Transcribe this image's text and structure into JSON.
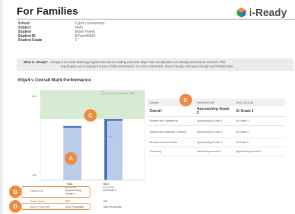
{
  "header": {
    "title": "For Families",
    "logo_text": "i-Ready"
  },
  "student_info": [
    {
      "label": "School",
      "value": "Cyprus Elementary"
    },
    {
      "label": "Subject",
      "value": "Math"
    },
    {
      "label": "Student",
      "value": "Elijah Powell"
    },
    {
      "label": "Student ID",
      "value": "EPowell6896"
    },
    {
      "label": "Student Grade",
      "value": "3"
    }
  ],
  "what_is": {
    "label": "What is i-Ready?",
    "line1": "i-Ready is an online learning program focused on reading and math. Elijah has recently taken an i-Ready assessment at school. This",
    "line2": "report gives you a snapshot of your child's performance. For more information about i-Ready, visit www.i-Ready.com/FamilyCenter."
  },
  "section_title": "Elijah's Overall Math Performance",
  "chart_data": {
    "type": "bar",
    "legend": "On Grade Level (487–540)",
    "y_ticks": [
      "540",
      "350"
    ],
    "ylim": [
      350,
      540
    ],
    "on_grade_band": [
      487,
      540
    ],
    "bars": [
      {
        "label_line1": "Test",
        "label_line2": "(09/16/20)",
        "value": 470,
        "emphasis": "solid"
      },
      {
        "label_line1": "Test",
        "label_line2": "(12/14/20)",
        "value": 487,
        "emphasis": "light"
      }
    ],
    "change_label": "+17"
  },
  "rows": {
    "placement_label": "Placement",
    "placement_values": [
      "Approaching Grade 3",
      "At Grade 3"
    ],
    "scale_label": "Scale Score",
    "scale_values": [
      "470",
      "487"
    ],
    "norm_label": "Norm Percentile",
    "norm_values": [
      "21st Percentile",
      "76th Percentile"
    ]
  },
  "table": {
    "headers": [
      "Domain",
      "Test (09/16/20)",
      "Test (12/14/20)"
    ],
    "overall": [
      "Overall",
      "Approaching Grade 3",
      "At Grade 3"
    ],
    "rows": [
      [
        "Number and Operations",
        "Approaching Grade 3",
        "At Grade 3"
      ],
      [
        "Algebra and Algebraic Thinking",
        "Approaching Grade 3",
        "At Grade 3"
      ],
      [
        "Measurement and Data",
        "Approaching Grade 3",
        "At Grade 3"
      ],
      [
        "Geometry",
        "Needs Improvement",
        "Approaching Grade 3"
      ]
    ]
  },
  "markers": {
    "a": "A",
    "b": "B",
    "c": "C",
    "d": "D",
    "e": "E"
  },
  "colors": {
    "accent": "#f08a3e",
    "band": "#d7ebd3",
    "bar_solid": "#3f6fb8",
    "bar_light": "#b9cdeb"
  }
}
